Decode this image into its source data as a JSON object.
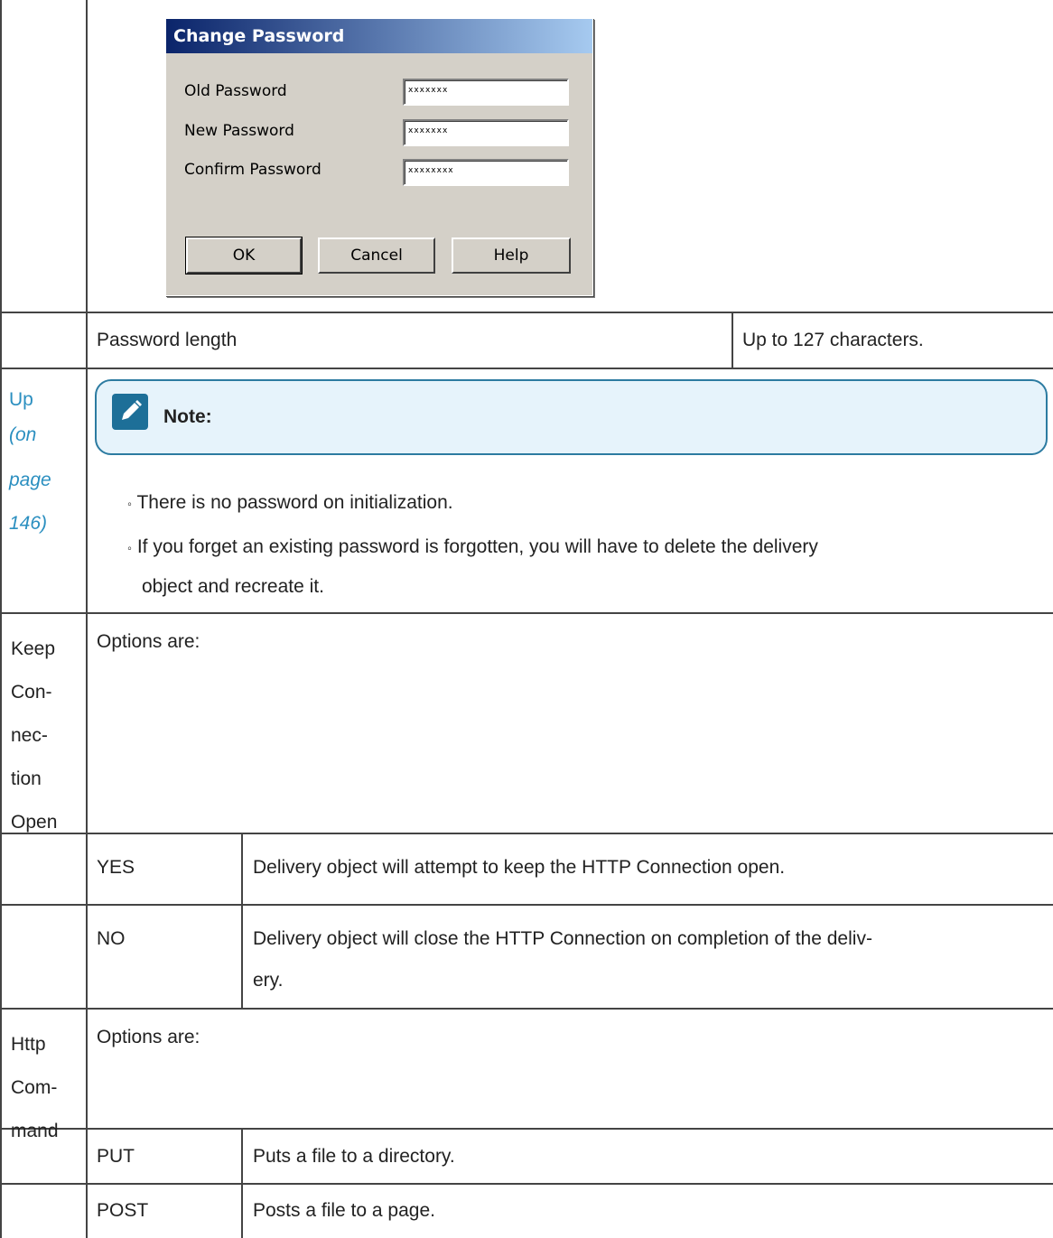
{
  "dialog": {
    "title": "Change Password",
    "fields": [
      {
        "label": "Old Password",
        "value": "xxxxxxx"
      },
      {
        "label": "New Password",
        "value": "xxxxxxx"
      },
      {
        "label": "Confirm Password",
        "value": "xxxxxxxx"
      }
    ],
    "buttons": {
      "ok": "OK",
      "cancel": "Cancel",
      "help": "Help"
    }
  },
  "rows": {
    "password_length": {
      "label": "Password length",
      "value": "Up to 127 characters."
    },
    "up_link": {
      "word": "Up",
      "on": "(on",
      "page": "page",
      "num": "146)"
    },
    "note": {
      "label": "Note:",
      "bullets": [
        "There is no password on initialization.",
        "If you forget an existing password is forgotten, you will have to delete the delivery",
        "object and recreate it."
      ]
    },
    "keep_connection": {
      "name_lines": [
        "Keep",
        "Con-",
        "nec-",
        "tion",
        "Open"
      ],
      "intro": "Options are:",
      "options": [
        {
          "key": "YES",
          "desc": [
            "Delivery object will attempt to keep the HTTP Connection open."
          ]
        },
        {
          "key": "NO",
          "desc": [
            "Delivery object will close the HTTP Connection on completion of the deliv-",
            "ery."
          ]
        }
      ]
    },
    "http_command": {
      "name_lines": [
        "Http",
        "Com-",
        "mand"
      ],
      "intro": "Options are:",
      "options": [
        {
          "key": "PUT",
          "desc": "Puts a file to a directory."
        },
        {
          "key": "POST",
          "desc": "Posts a file to a page."
        }
      ]
    }
  },
  "colors": {
    "note_border": "#2c7ba1",
    "note_bg": "#e6f3fb",
    "link": "#2b8fc0",
    "dialog_bg": "#d4d0c8"
  },
  "icons": {
    "note": "pencil-edit-icon"
  }
}
